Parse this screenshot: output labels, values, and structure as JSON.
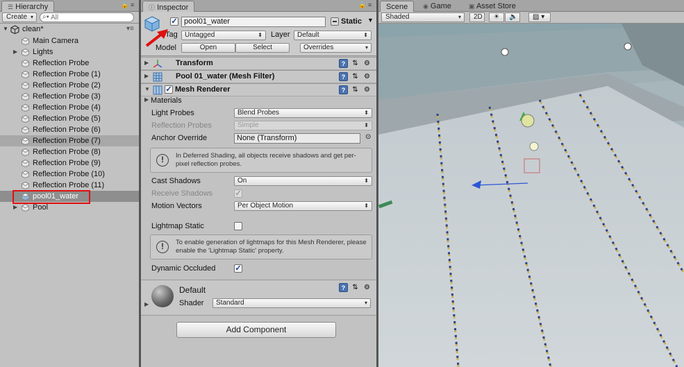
{
  "hierarchy": {
    "tab_label": "Hierarchy",
    "create_label": "Create",
    "search_placeholder": "All",
    "scene_name": "clean*",
    "items": [
      {
        "label": "Main Camera",
        "has_children": false
      },
      {
        "label": "Lights",
        "has_children": true
      },
      {
        "label": "Reflection Probe",
        "has_children": false
      },
      {
        "label": "Reflection Probe (1)",
        "has_children": false
      },
      {
        "label": "Reflection Probe (2)",
        "has_children": false
      },
      {
        "label": "Reflection Probe (3)",
        "has_children": false
      },
      {
        "label": "Reflection Probe (4)",
        "has_children": false
      },
      {
        "label": "Reflection Probe (5)",
        "has_children": false
      },
      {
        "label": "Reflection Probe (6)",
        "has_children": false
      },
      {
        "label": "Reflection Probe (7)",
        "has_children": false,
        "highlighted": true
      },
      {
        "label": "Reflection Probe (8)",
        "has_children": false
      },
      {
        "label": "Reflection Probe (9)",
        "has_children": false
      },
      {
        "label": "Reflection Probe (10)",
        "has_children": false
      },
      {
        "label": "Reflection Probe (11)",
        "has_children": false
      },
      {
        "label": "pool01_water",
        "has_children": false,
        "selected": true
      },
      {
        "label": "Pool",
        "has_children": true
      }
    ]
  },
  "inspector": {
    "tab_label": "Inspector",
    "object_name": "pool01_water",
    "active": true,
    "static_label": "Static",
    "tag_label": "Tag",
    "tag_value": "Untagged",
    "layer_label": "Layer",
    "layer_value": "Default",
    "model_label": "Model",
    "open_label": "Open",
    "select_label": "Select",
    "overrides_label": "Overrides",
    "components": {
      "transform": "Transform",
      "mesh_filter": "Pool 01_water (Mesh Filter)",
      "mesh_renderer": "Mesh Renderer"
    },
    "materials_label": "Materials",
    "light_probes_label": "Light Probes",
    "light_probes_value": "Blend Probes",
    "reflection_probes_label": "Reflection Probes",
    "reflection_probes_value": "Simple",
    "anchor_override_label": "Anchor Override",
    "anchor_override_value": "None (Transform)",
    "info1": "In Deferred Shading, all objects receive shadows and get per-pixel reflection probes.",
    "cast_shadows_label": "Cast Shadows",
    "cast_shadows_value": "On",
    "receive_shadows_label": "Receive Shadows",
    "motion_vectors_label": "Motion Vectors",
    "motion_vectors_value": "Per Object Motion",
    "lightmap_static_label": "Lightmap Static",
    "lightmap_static": false,
    "info2": "To enable generation of lightmaps for this Mesh Renderer, please enable the 'Lightmap Static' property.",
    "dynamic_occluded_label": "Dynamic Occluded",
    "dynamic_occluded": true,
    "material_name": "Default",
    "shader_label": "Shader",
    "shader_value": "Standard",
    "add_component_label": "Add Component"
  },
  "scene": {
    "tabs": [
      "Scene",
      "Game",
      "Asset Store"
    ],
    "shading_mode": "Shaded",
    "mode_2d_label": "2D"
  },
  "colors": {
    "highlight_box": "#e01010",
    "arrow": "#e01010",
    "selection_text": "#ffffff",
    "lane_blue": "#2c3f8c",
    "lane_yellow": "#c9ae55",
    "pool_floor": "#c8d0d5"
  }
}
